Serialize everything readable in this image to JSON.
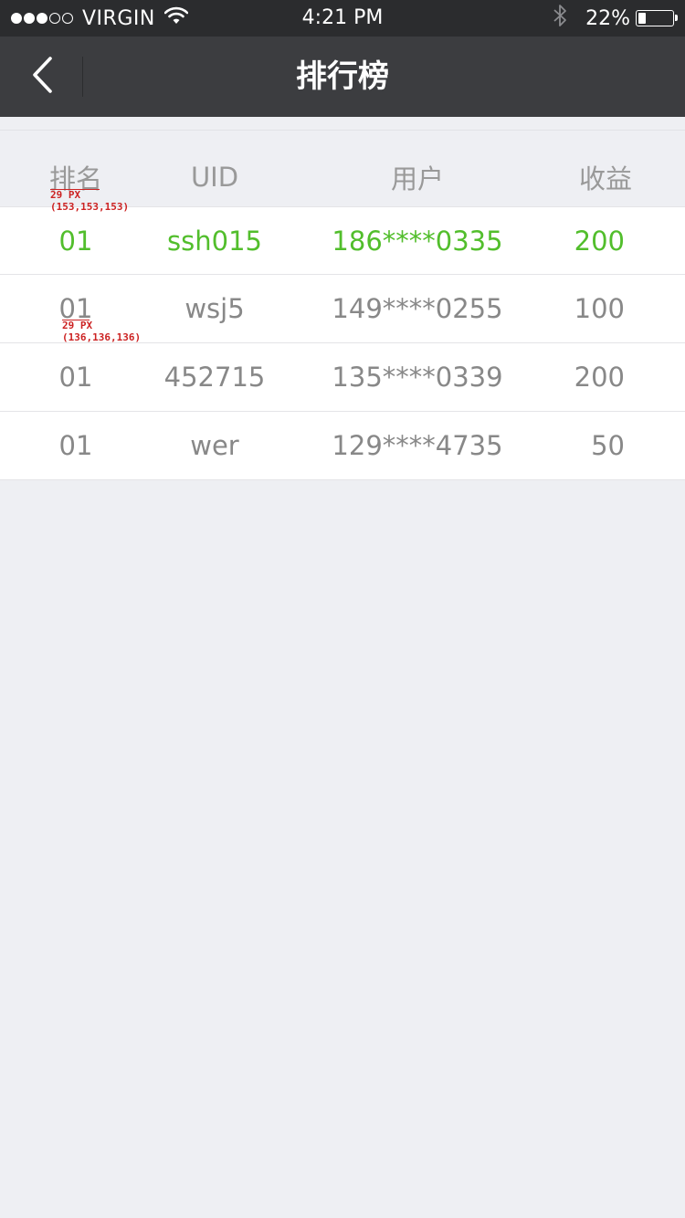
{
  "status_bar": {
    "carrier": "VIRGIN",
    "signal_dots_filled": 3,
    "signal_dots_total": 5,
    "time": "4:21 PM",
    "battery_percent": "22%",
    "battery_level": 0.22,
    "icons": [
      "wifi-icon",
      "bluetooth-icon",
      "battery-icon"
    ]
  },
  "nav_bar": {
    "title": "排行榜",
    "back_icon": "chevron-left-icon"
  },
  "table": {
    "columns": {
      "rank": "排名",
      "uid": "UID",
      "user": "用户",
      "earnings": "收益"
    },
    "rows": [
      {
        "rank": "01",
        "uid": "ssh015",
        "user": "186****0335",
        "earnings": "200",
        "highlight": true
      },
      {
        "rank": "01",
        "uid": "wsj5",
        "user": "149****0255",
        "earnings": "100",
        "highlight": false
      },
      {
        "rank": "01",
        "uid": "452715",
        "user": "135****0339",
        "earnings": "200",
        "highlight": false
      },
      {
        "rank": "01",
        "uid": "wer",
        "user": "129****4735",
        "earnings": "50",
        "highlight": false
      }
    ]
  },
  "annotations": {
    "header_size": "29 PX",
    "header_color": "(153,153,153)",
    "row_size": "29 PX",
    "row_color": "(136,136,136)"
  },
  "colors": {
    "highlight_green": "#52be2c",
    "header_text": "#999999",
    "row_text": "#888888",
    "nav_bg": "#3c3d40",
    "status_bg": "#2b2c2e",
    "page_bg": "#eeeff3"
  }
}
